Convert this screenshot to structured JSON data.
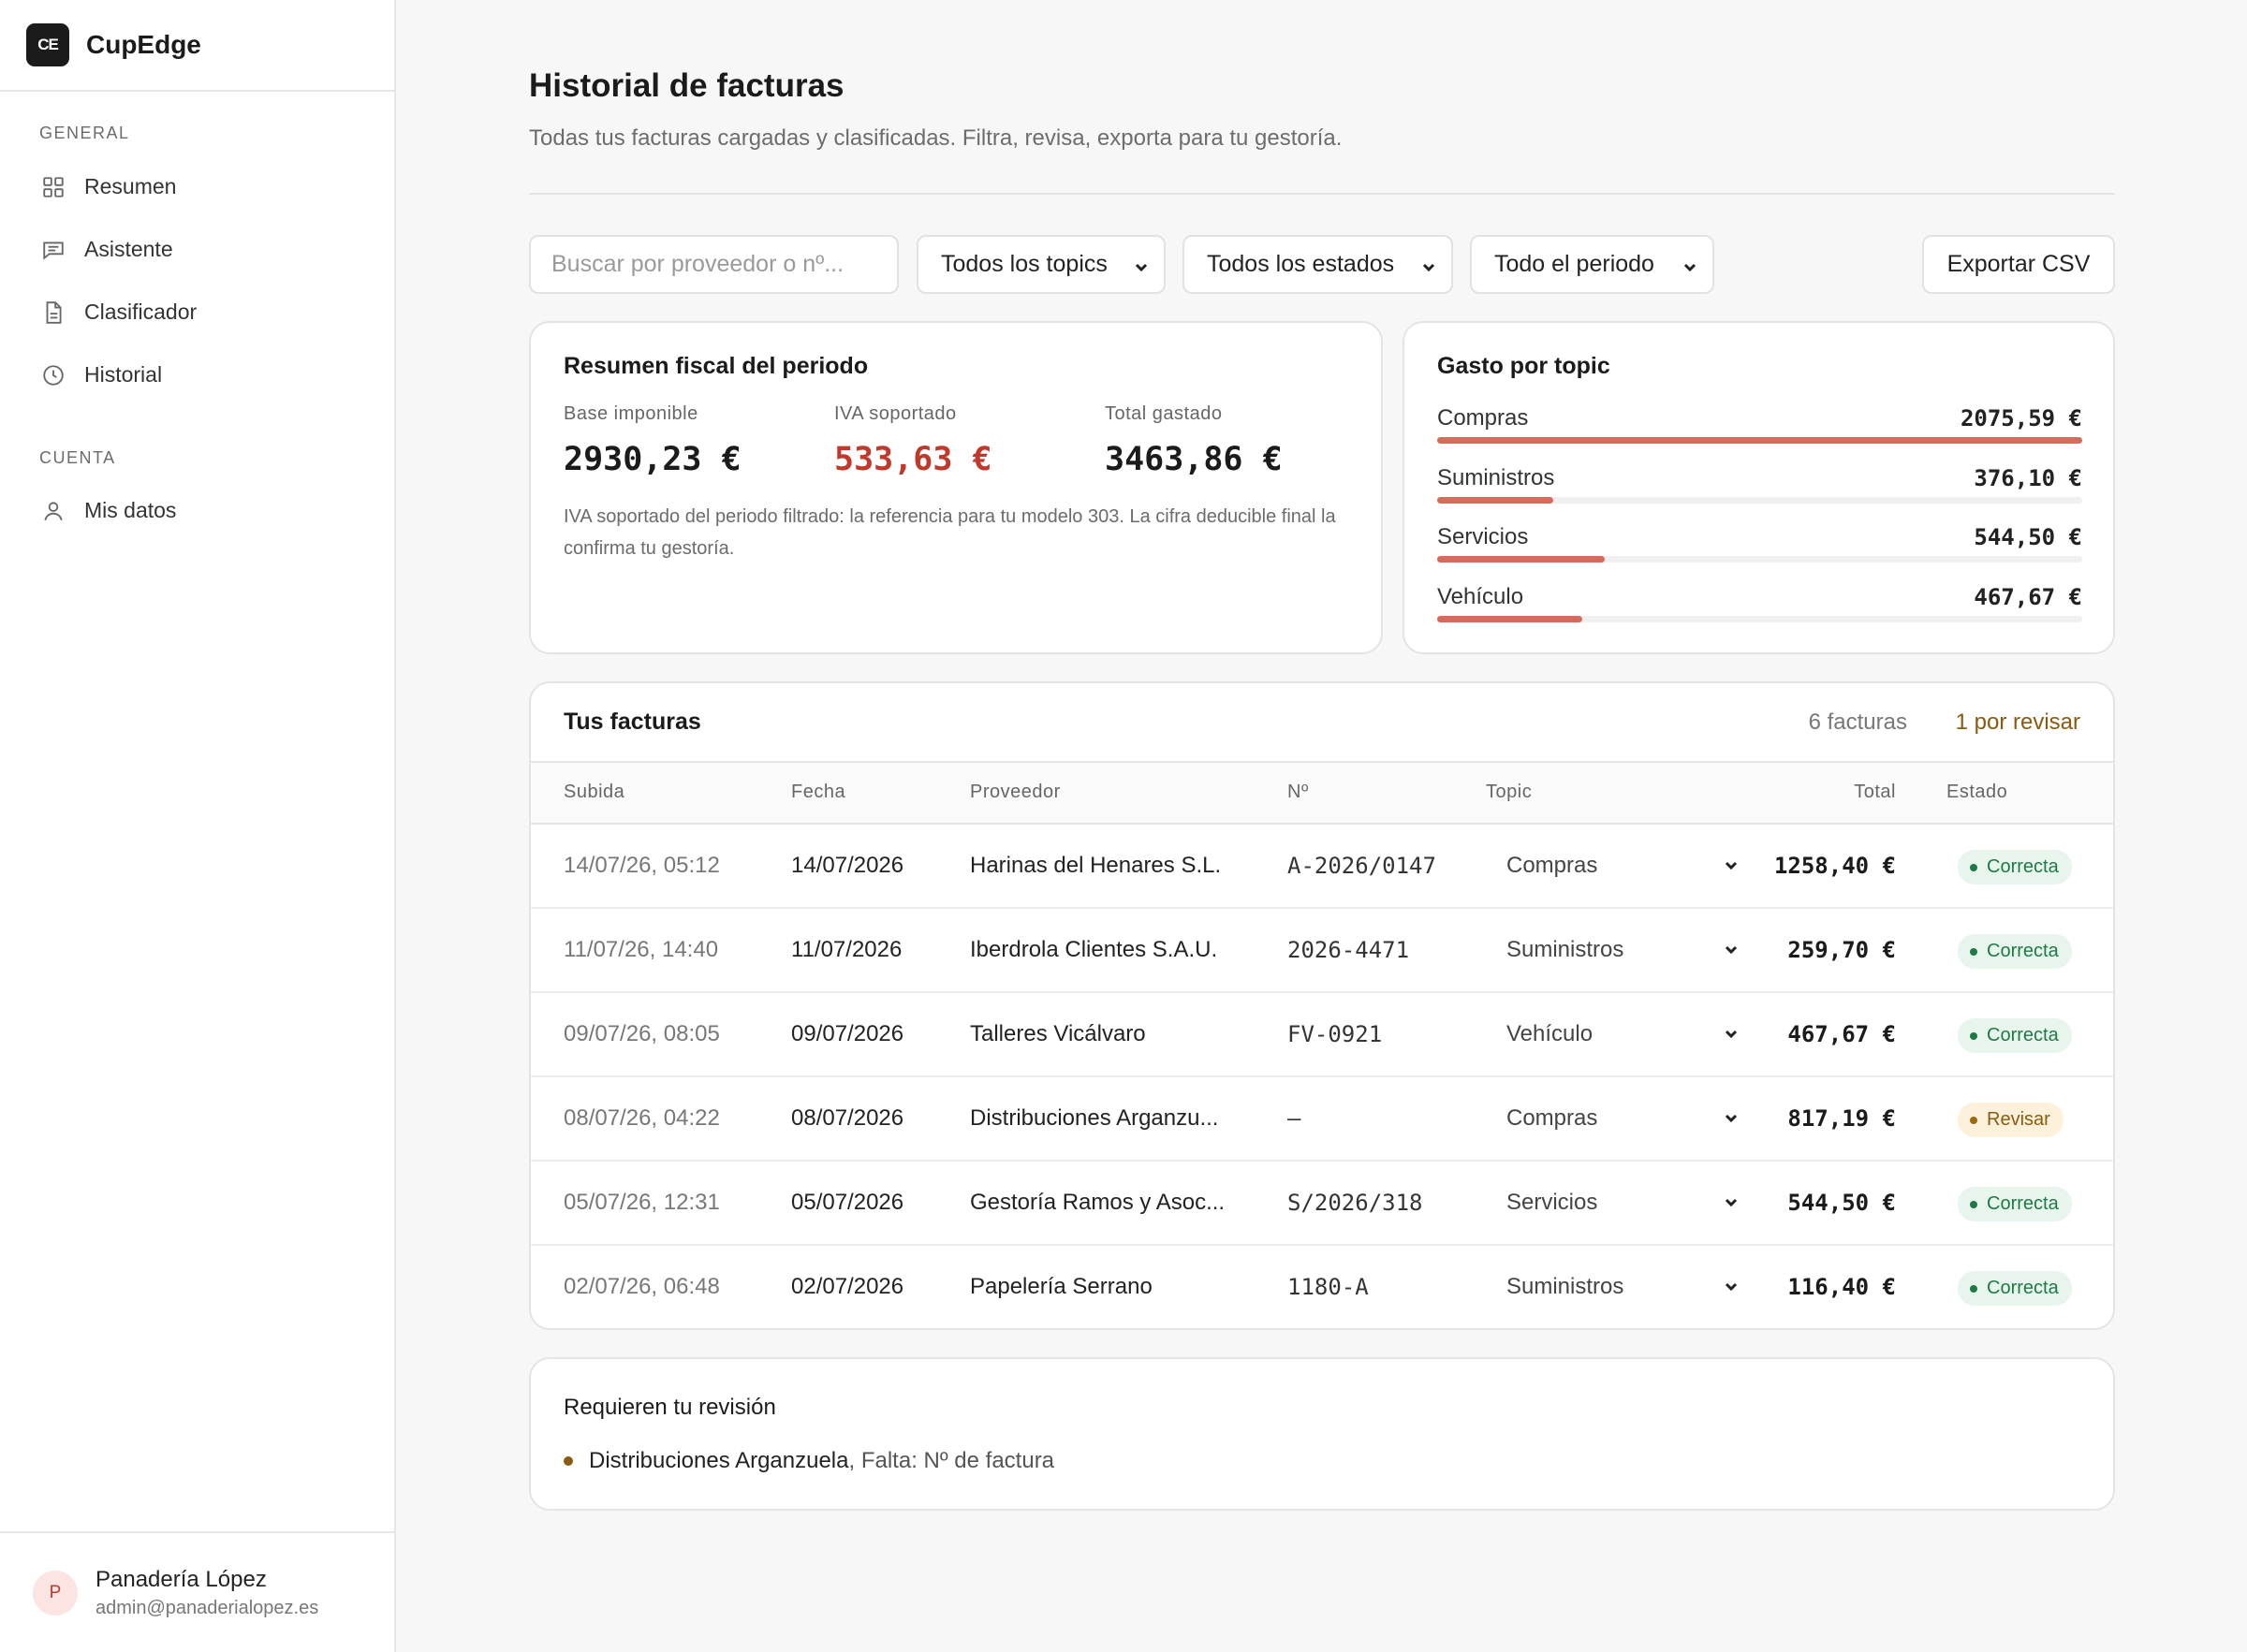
{
  "brand": {
    "logo_text": "CE",
    "name": "CupEdge"
  },
  "sidebar": {
    "sections": [
      {
        "label": "GENERAL"
      },
      {
        "label": "CUENTA"
      }
    ],
    "items": [
      {
        "label": "Resumen",
        "icon": "grid-icon"
      },
      {
        "label": "Asistente",
        "icon": "chat-icon"
      },
      {
        "label": "Clasificador",
        "icon": "document-icon"
      },
      {
        "label": "Historial",
        "icon": "clock-icon"
      },
      {
        "label": "Mis datos",
        "icon": "user-icon"
      }
    ],
    "user": {
      "initial": "P",
      "name": "Panadería López",
      "email": "admin@panaderialopez.es"
    }
  },
  "page": {
    "title": "Historial de facturas",
    "subtitle": "Todas tus facturas cargadas y clasificadas. Filtra, revisa, exporta para tu gestoría."
  },
  "filters": {
    "search_placeholder": "Buscar por proveedor o nº...",
    "topic": "Todos los topics",
    "state": "Todos los estados",
    "period": "Todo el periodo",
    "export_label": "Exportar CSV"
  },
  "fiscal": {
    "title": "Resumen fiscal del periodo",
    "base_label": "Base imponible",
    "base_value": "2930,23 €",
    "iva_label": "IVA soportado",
    "iva_value": "533,63 €",
    "total_label": "Total gastado",
    "total_value": "3463,86 €",
    "note": "IVA soportado del periodo filtrado: la referencia para tu modelo 303. La cifra deducible final la confirma tu gestoría.",
    "accent_color": "#c0392b"
  },
  "topics": {
    "title": "Gasto por topic",
    "bar_color": "#d9695b",
    "items": [
      {
        "name": "Compras",
        "value": "2075,59 €",
        "fraction": 1.0
      },
      {
        "name": "Suministros",
        "value": "376,10 €",
        "fraction": 0.18
      },
      {
        "name": "Servicios",
        "value": "544,50 €",
        "fraction": 0.26
      },
      {
        "name": "Vehículo",
        "value": "467,67 €",
        "fraction": 0.225
      }
    ]
  },
  "invoices": {
    "title": "Tus facturas",
    "count_label": "6 facturas",
    "review_label": "1 por revisar",
    "columns": [
      "Subida",
      "Fecha",
      "Proveedor",
      "Nº",
      "Topic",
      "Total",
      "Estado"
    ],
    "rows": [
      {
        "uploaded": "14/07/26, 05:12",
        "date": "14/07/2026",
        "supplier": "Harinas del Henares S.L.",
        "number": "A-2026/0147",
        "topic": "Compras",
        "total": "1258,40 €",
        "status": "Correcta",
        "status_kind": "ok"
      },
      {
        "uploaded": "11/07/26, 14:40",
        "date": "11/07/2026",
        "supplier": "Iberdrola Clientes S.A.U.",
        "number": "2026-4471",
        "topic": "Suministros",
        "total": "259,70 €",
        "status": "Correcta",
        "status_kind": "ok"
      },
      {
        "uploaded": "09/07/26, 08:05",
        "date": "09/07/2026",
        "supplier": "Talleres Vicálvaro",
        "number": "FV-0921",
        "topic": "Vehículo",
        "total": "467,67 €",
        "status": "Correcta",
        "status_kind": "ok"
      },
      {
        "uploaded": "08/07/26, 04:22",
        "date": "08/07/2026",
        "supplier": "Distribuciones Arganzu...",
        "number": "—",
        "topic": "Compras",
        "total": "817,19 €",
        "status": "Revisar",
        "status_kind": "rev"
      },
      {
        "uploaded": "05/07/26, 12:31",
        "date": "05/07/2026",
        "supplier": "Gestoría Ramos y Asoc...",
        "number": "S/2026/318",
        "topic": "Servicios",
        "total": "544,50 €",
        "status": "Correcta",
        "status_kind": "ok"
      },
      {
        "uploaded": "02/07/26, 06:48",
        "date": "02/07/2026",
        "supplier": "Papelería Serrano",
        "number": "1180-A",
        "topic": "Suministros",
        "total": "116,40 €",
        "status": "Correcta",
        "status_kind": "ok"
      }
    ]
  },
  "review": {
    "title": "Requieren tu revisión",
    "items": [
      {
        "supplier": "Distribuciones Arganzuela",
        "issue": ", Falta: Nº de factura"
      }
    ]
  }
}
